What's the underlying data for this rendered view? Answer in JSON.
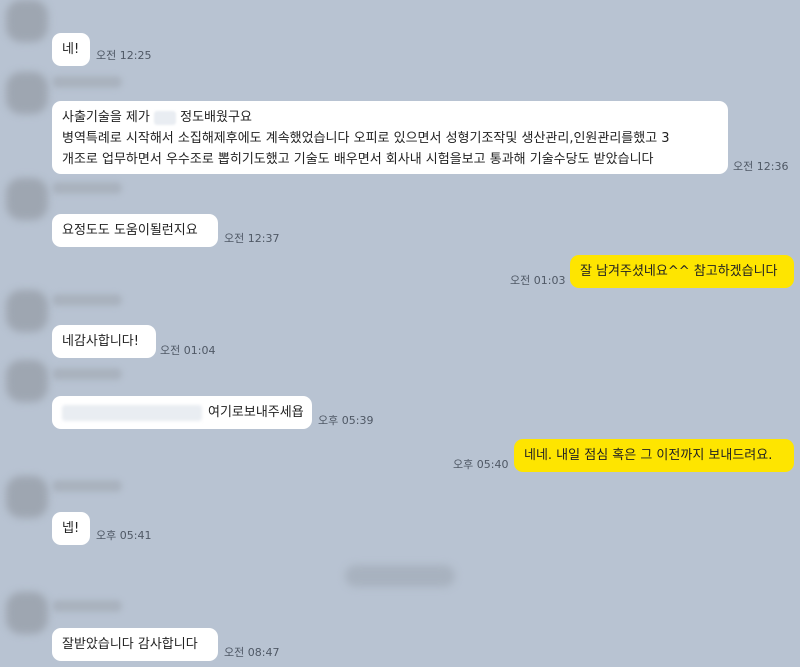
{
  "messages": [
    {
      "text": "네!",
      "time": "오전 12:25"
    },
    {
      "lines": [
        "사출기술을 제가",
        "정도배웠구요",
        "병역특례로 시작해서 소집해제후에도 계속했었습니다 오피로 있으면서 성형기조작및 생산관리,인원관리를했고 3",
        "개조로 업무하면서 우수조로 뽑히기도했고 기술도 배우면서 회사내 시험을보고 통과해 기술수당도 받았습니다"
      ],
      "time": "오전 12:36"
    },
    {
      "text": "요정도도 도움이될런지요",
      "time": "오전 12:37"
    },
    {
      "text": "잘 남겨주셨네요^^ 참고하겠습니다",
      "time": "오전 01:03"
    },
    {
      "text": "네감사합니다!",
      "time": "오전 01:04"
    },
    {
      "text": "여기로보내주세욥",
      "time": "오후 05:39"
    },
    {
      "text": "네네. 내일 점심 혹은 그 이전까지 보내드려요.",
      "time": "오후 05:40"
    },
    {
      "text": "넵!",
      "time": "오후 05:41"
    },
    {
      "text": "잘받았습니다 감사합니다",
      "time": "오전 08:47"
    }
  ]
}
